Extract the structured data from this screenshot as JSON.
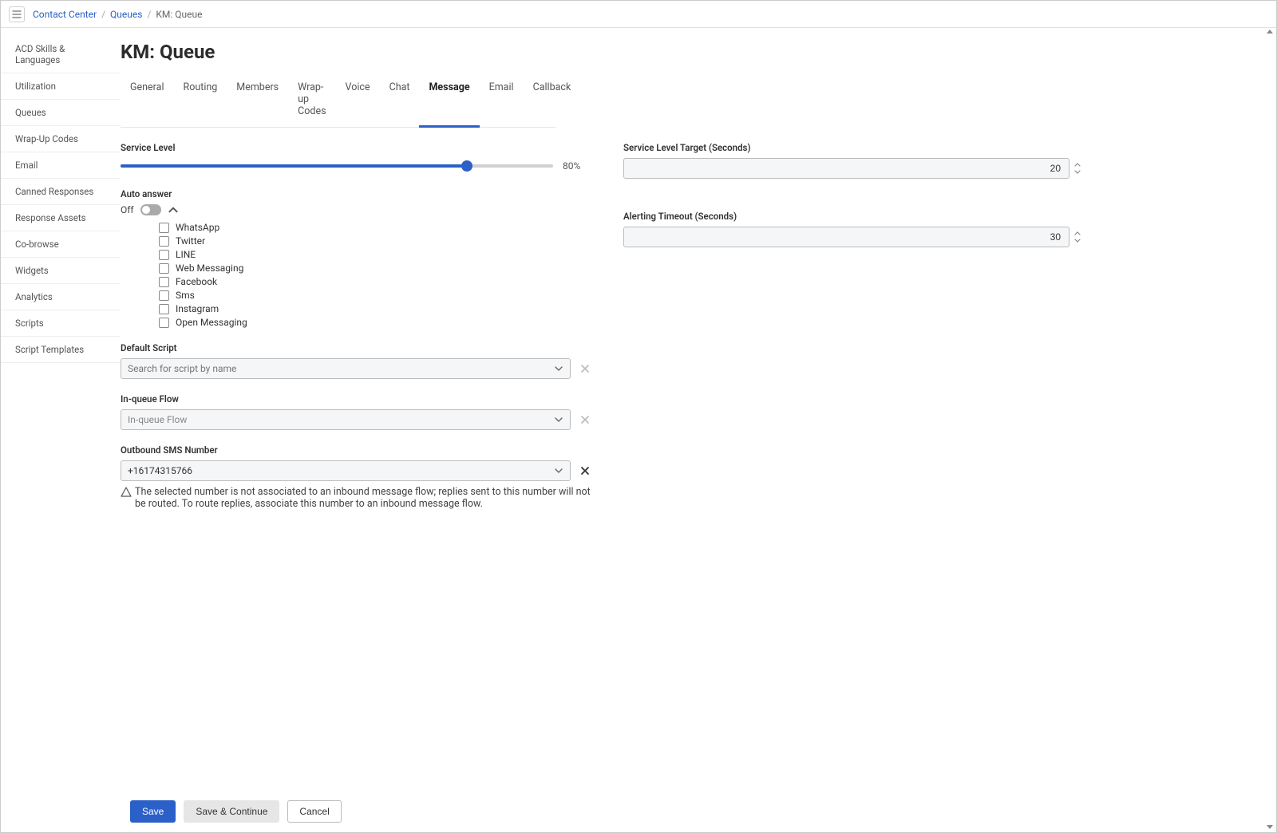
{
  "breadcrumb": {
    "items": [
      {
        "label": "Contact Center",
        "link": true
      },
      {
        "label": "Queues",
        "link": true
      },
      {
        "label": "KM: Queue",
        "link": false
      }
    ]
  },
  "page": {
    "title": "KM: Queue"
  },
  "sidebar": {
    "items": [
      "ACD Skills & Languages",
      "Utilization",
      "Queues",
      "Wrap-Up Codes",
      "Email",
      "Canned Responses",
      "Response Assets",
      "Co-browse",
      "Widgets",
      "Analytics",
      "Scripts",
      "Script Templates"
    ]
  },
  "tabs": {
    "items": [
      "General",
      "Routing",
      "Members",
      "Wrap-up Codes",
      "Voice",
      "Chat",
      "Message",
      "Email",
      "Callback"
    ],
    "active": "Message"
  },
  "labels": {
    "service_level": "Service Level",
    "service_level_target": "Service Level Target (Seconds)",
    "alerting_timeout": "Alerting Timeout (Seconds)",
    "auto_answer": "Auto answer",
    "off": "Off",
    "default_script": "Default Script",
    "in_queue_flow": "In-queue Flow",
    "outbound_sms": "Outbound SMS Number"
  },
  "values": {
    "service_level_percent": "80%",
    "service_level_fill_pct": 80,
    "service_level_target": "20",
    "alerting_timeout": "30",
    "default_script_placeholder": "Search for script by name",
    "in_queue_flow_value": "In-queue Flow",
    "outbound_sms_value": "+16174315766",
    "outbound_sms_warning": "The selected number is not associated to an inbound message flow; replies sent to this number will not be routed. To route replies, associate this number to an inbound message flow."
  },
  "auto_answer_options": [
    "WhatsApp",
    "Twitter",
    "LINE",
    "Web Messaging",
    "Facebook",
    "Sms",
    "Instagram",
    "Open Messaging"
  ],
  "buttons": {
    "save": "Save",
    "save_continue": "Save & Continue",
    "cancel": "Cancel"
  }
}
